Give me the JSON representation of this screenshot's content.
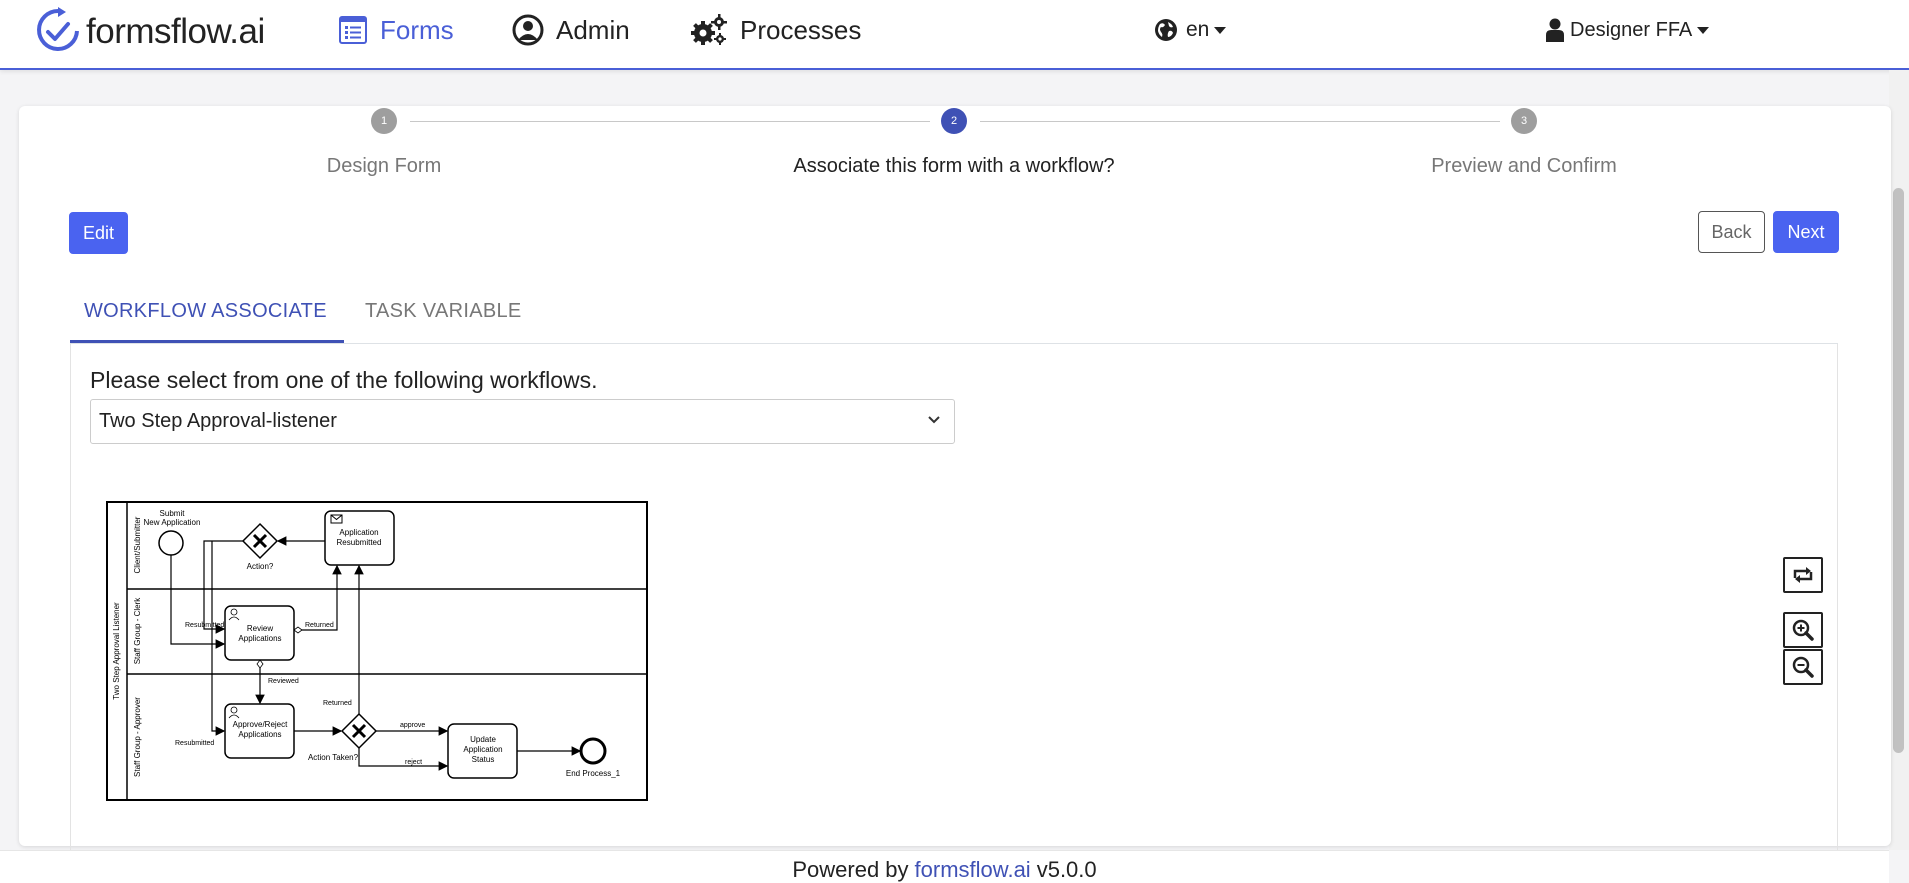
{
  "navbar": {
    "brand": "formsflow.ai",
    "items": [
      {
        "label": "Forms",
        "icon": "forms-icon",
        "active": true
      },
      {
        "label": "Admin",
        "icon": "user-circle-icon",
        "active": false
      },
      {
        "label": "Processes",
        "icon": "cogs-icon",
        "active": false
      }
    ],
    "language": "en",
    "user": "Designer FFA"
  },
  "stepper": {
    "steps": [
      {
        "number": "1",
        "label": "Design Form"
      },
      {
        "number": "2",
        "label": "Associate this form with a workflow?"
      },
      {
        "number": "3",
        "label": "Preview and Confirm"
      }
    ],
    "active_index": 1
  },
  "actions": {
    "edit": "Edit",
    "back": "Back",
    "next": "Next"
  },
  "tabs": {
    "workflow_associate": "WORKFLOW ASSOCIATE",
    "task_variable": "TASK VARIABLE"
  },
  "workflow": {
    "prompt": "Please select from one of the following workflows.",
    "selected": "Two Step Approval-listener"
  },
  "diagram": {
    "pool_name": "Two Step Approval Listener",
    "lanes": [
      "Client/Submitter",
      "Staff Group - Clerk",
      "Staff Group - Approver"
    ],
    "tasks": {
      "resubmitted_line1": "Application",
      "resubmitted_line2": "Resubmitted",
      "review_line1": "Review",
      "review_line2": "Applications",
      "approve_line1": "Approve/Reject",
      "approve_line2": "Applications",
      "update_line1": "Update",
      "update_line2": "Application",
      "update_line3": "Status"
    },
    "labels": {
      "submit_line1": "Submit",
      "submit_line2": "New Application",
      "action": "Action?",
      "resubmitted_a": "Resubmitted",
      "returned_a": "Returned",
      "reviewed": "Reviewed",
      "returned_b": "Returned",
      "resubmitted_b": "Resubmitted",
      "action_taken": "Action Taken?",
      "approve": "approve",
      "reject": "reject",
      "end": "End Process_1"
    }
  },
  "canvas_controls": [
    "reset-view-icon",
    "zoom-in-icon",
    "zoom-out-icon"
  ],
  "footer": {
    "prefix": "Powered by",
    "link": "formsflow.ai",
    "version": "v5.0.0"
  },
  "colors": {
    "accent": "#4a5fd7",
    "primary_button": "#4a63f0",
    "step_active": "#3f51b5",
    "step_inactive": "#9e9e9e"
  }
}
